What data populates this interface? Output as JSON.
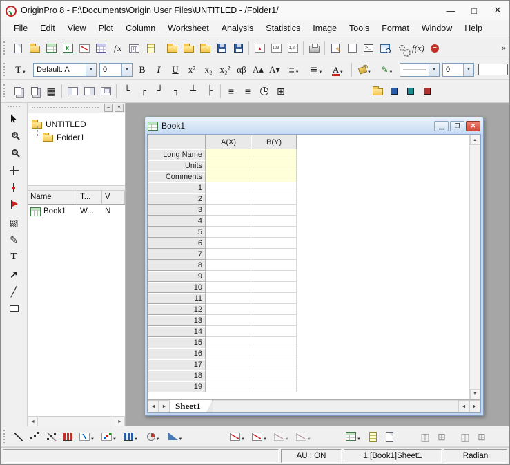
{
  "titlebar": {
    "title": "OriginPro 8 - F:\\Documents\\Origin User Files\\UNTITLED - /Folder1/",
    "minimize": "—",
    "maximize": "□",
    "close": "✕"
  },
  "menu": {
    "items": [
      "File",
      "Edit",
      "View",
      "Plot",
      "Column",
      "Worksheet",
      "Analysis",
      "Statistics",
      "Image",
      "Tools",
      "Format",
      "Window",
      "Help"
    ]
  },
  "toolbar_standard": {
    "overflow": "»",
    "items": [
      {
        "name": "new-project",
        "kind": "page"
      },
      {
        "name": "new-folder",
        "kind": "folder"
      },
      {
        "name": "new-workbook",
        "kind": "wks"
      },
      {
        "name": "new-excel",
        "kind": "excel"
      },
      {
        "name": "new-graph",
        "kind": "graph"
      },
      {
        "name": "new-matrix",
        "kind": "matrix"
      },
      {
        "name": "new-function-plot",
        "text": "ƒx",
        "cls": "txt-serif txt-i"
      },
      {
        "name": "new-layout",
        "kind": "layout"
      },
      {
        "name": "new-notes",
        "kind": "notes"
      },
      {
        "sep": true
      },
      {
        "name": "open",
        "kind": "folder"
      },
      {
        "name": "open-excel",
        "kind": "folder folder-excel"
      },
      {
        "name": "open-sample",
        "kind": "folder folder-sample"
      },
      {
        "name": "save-project",
        "kind": "disk"
      },
      {
        "name": "save-template",
        "kind": "disk"
      },
      {
        "sep": true
      },
      {
        "name": "import-wizard",
        "kind": "impwiz"
      },
      {
        "name": "import-single-ascii",
        "kind": "imp1"
      },
      {
        "name": "import-multiple-ascii",
        "kind": "imp2"
      },
      {
        "sep": true
      },
      {
        "name": "print",
        "kind": "printer"
      },
      {
        "sep": true
      },
      {
        "name": "digitize-image",
        "kind": "digit"
      },
      {
        "name": "results-log",
        "kind": "rlog"
      },
      {
        "name": "script-window",
        "kind": "cmdw"
      },
      {
        "name": "project-explorer",
        "kind": "pexp"
      },
      {
        "name": "code-builder",
        "kind": "gears"
      },
      {
        "name": "fitting-function-organizer",
        "text": "f(x)",
        "cls": "txt-serif txt-i"
      },
      {
        "name": "origin-central",
        "kind": "central"
      }
    ]
  },
  "toolbar_format": {
    "format_tool_label": "T",
    "style_field": "Default: A",
    "size_field": "0",
    "buttons": [
      {
        "name": "bold",
        "text": "B",
        "cls": "txt-serif txt-b"
      },
      {
        "name": "italic",
        "text": "I",
        "cls": "txt-serif txt-i txt-b"
      },
      {
        "name": "underline",
        "text": "U",
        "cls": "txt-serif txt-u"
      },
      {
        "name": "superscript",
        "text": "x²",
        "cls": "txt-serif"
      },
      {
        "name": "subscript",
        "text": "x₂",
        "cls": "txt-serif"
      },
      {
        "name": "sub-superscript",
        "text": "x₂²",
        "cls": "txt-serif"
      },
      {
        "name": "greek",
        "text": "αβ",
        "cls": "txt-serif"
      },
      {
        "name": "increase-font",
        "text": "A▴",
        "cls": "txt-serif"
      },
      {
        "name": "decrease-font",
        "text": "A▾",
        "cls": "txt-serif"
      },
      {
        "name": "paragraph-align",
        "text": "≡",
        "cls": "txt-big",
        "dd": true
      },
      {
        "name": "line-spacing",
        "text": "≣",
        "cls": "txt-big",
        "dd": true
      },
      {
        "name": "font-color",
        "text": "A",
        "cls": "fcolor",
        "dd": true
      }
    ],
    "fill_color_name": "fill-color",
    "line_color_name": "line-color",
    "line_style_field": "———",
    "line_width_field": "0"
  },
  "toolbar_layout": {
    "items": [
      {
        "name": "duplicate-window",
        "kind": "dup"
      },
      {
        "name": "refresh-window",
        "kind": "dup"
      },
      {
        "name": "worksheet-grid-view",
        "text": "▦",
        "cls": "txt-big"
      },
      {
        "sep": true
      },
      {
        "name": "add-layer-left",
        "kind": "lay1"
      },
      {
        "name": "add-layer-right",
        "kind": "lay2"
      },
      {
        "name": "add-inset-layer",
        "kind": "lay3"
      },
      {
        "sep": true
      },
      {
        "name": "axes-left-bottom",
        "text": "└",
        "cls": "txt-mono"
      },
      {
        "name": "axes-left-top",
        "text": "┌",
        "cls": "txt-mono"
      },
      {
        "name": "axes-right-bottom",
        "text": "┘",
        "cls": "txt-mono"
      },
      {
        "name": "axes-right-top",
        "text": "┐",
        "cls": "txt-mono"
      },
      {
        "name": "axes-bottom",
        "text": "┴",
        "cls": "txt-mono"
      },
      {
        "name": "axes-left",
        "text": "├",
        "cls": "txt-mono"
      },
      {
        "sep": true
      },
      {
        "name": "stack-horizontal",
        "text": "≡",
        "cls": "txt-big"
      },
      {
        "name": "stack-vertical",
        "text": "≡",
        "cls": "txt-big"
      },
      {
        "name": "update-clock",
        "kind": "clock"
      },
      {
        "name": "show-grid",
        "text": "⊞",
        "cls": "txt-big"
      },
      {
        "gap": 92
      },
      {
        "name": "draw-marker",
        "kind": "peny",
        "text": "✎"
      },
      {
        "name": "edit-annotation-folder",
        "kind": "folder folderpen"
      },
      {
        "name": "add-data-marker",
        "kind": "mk-b"
      },
      {
        "name": "move-data-marker",
        "kind": "mk-t"
      },
      {
        "name": "remove-data-marker",
        "kind": "mk-r"
      }
    ]
  },
  "tools_palette": {
    "items": [
      {
        "name": "pointer-tool",
        "kind": "pointer"
      },
      {
        "name": "zoom-in-tool",
        "kind": "magp"
      },
      {
        "name": "zoom-out-tool",
        "kind": "magm"
      },
      {
        "name": "screen-reader-tool",
        "kind": "cross"
      },
      {
        "name": "data-reader-tool",
        "kind": "crossdot"
      },
      {
        "name": "data-selector-tool",
        "kind": "flag"
      },
      {
        "name": "mask-tool",
        "text": "▧",
        "cls": "txt-big"
      },
      {
        "name": "draw-data-tool",
        "text": "✎",
        "cls": "txt-big"
      },
      {
        "name": "text-tool",
        "text": "T",
        "cls": "txt-serif txt-b txt-big"
      },
      {
        "name": "arrow-tool",
        "text": "↗",
        "cls": "txt-b txt-big"
      },
      {
        "name": "line-tool",
        "text": "╱",
        "cls": "txt-big"
      },
      {
        "name": "rectangle-tool",
        "kind": "rect"
      }
    ]
  },
  "toolbar_graphs": {
    "items": [
      {
        "name": "line-plot",
        "kind": "pl-line"
      },
      {
        "name": "scatter-plot",
        "kind": "pl-scatter"
      },
      {
        "name": "line-symbol-plot",
        "kind": "pl-ls"
      },
      {
        "name": "column-plot",
        "kind": "pl-col"
      },
      {
        "name": "special-line-dropdown",
        "kind": "pl-lspec",
        "dd": true
      },
      {
        "name": "special-symbol-dropdown",
        "kind": "pl-sspec",
        "dd": true
      },
      {
        "name": "special-bar-dropdown",
        "kind": "pl-bspec",
        "dd": true
      },
      {
        "name": "pie-chart-dropdown",
        "kind": "pl-pie",
        "dd": true
      },
      {
        "name": "area-plot-dropdown",
        "kind": "pl-area",
        "dd": true
      },
      {
        "gap": 58
      },
      {
        "name": "graph-template-dropdown",
        "kind": "gtmpl",
        "dd": true
      },
      {
        "name": "template-library-dropdown",
        "kind": "gtmpl",
        "dd": true
      },
      {
        "name": "add-plot-dropdown",
        "kind": "gtmpl",
        "dd": true,
        "dis": true
      },
      {
        "name": "rescale-dropdown",
        "kind": "gtmpl",
        "dd": true,
        "dis": true
      },
      {
        "gap": 40
      },
      {
        "name": "new-matrix-dropdown",
        "kind": "mgrid",
        "dd": true
      },
      {
        "name": "new-sheet",
        "kind": "notes"
      },
      {
        "name": "duplicate-book",
        "kind": "page"
      },
      {
        "gap": 28
      },
      {
        "name": "arrange-layers-horizontal",
        "text": "◫",
        "cls": "txt-big",
        "dis": true
      },
      {
        "name": "arrange-layers-vertical",
        "text": "⊞",
        "cls": "txt-big",
        "dis": true
      },
      {
        "gap": 10
      },
      {
        "name": "tile-windows-horizontal",
        "text": "◫",
        "cls": "txt-big",
        "dis": true
      },
      {
        "name": "tile-windows-vertical",
        "text": "⊞",
        "cls": "txt-big",
        "dis": true
      }
    ]
  },
  "project_explorer": {
    "controls": {
      "minimize": "–",
      "close": "×"
    },
    "tree": [
      {
        "label": "UNTITLED",
        "level": 0
      },
      {
        "label": "Folder1",
        "level": 1
      }
    ],
    "columns": [
      "Name",
      "T...",
      "V"
    ],
    "rows": [
      {
        "name": "Book1",
        "type": "W...",
        "view": "N"
      }
    ],
    "scroll": {
      "left": "◄",
      "right": "►"
    }
  },
  "book": {
    "title": "Book1",
    "controls": {
      "minimize": "▁",
      "restore": "❐",
      "close": "✕"
    },
    "columns": [
      "A(X)",
      "B(Y)"
    ],
    "label_rows": [
      "Long Name",
      "Units",
      "Comments"
    ],
    "row_count": 19,
    "sheet": "Sheet1",
    "scroll": {
      "up": "▲",
      "down": "▼",
      "left": "◄",
      "right": "►"
    }
  },
  "status": {
    "auto_update": "AU : ON",
    "active_window": "1:[Book1]Sheet1",
    "angle_unit": "Radian"
  }
}
